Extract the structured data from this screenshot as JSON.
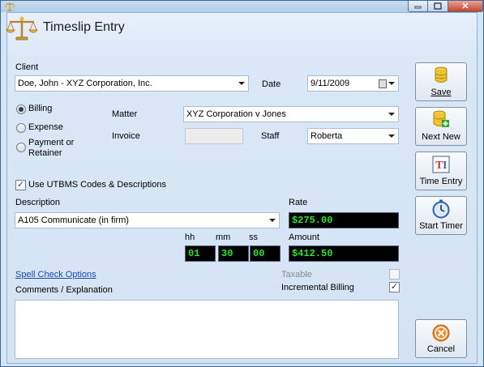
{
  "header": {
    "title": "Timeslip Entry"
  },
  "client": {
    "label": "Client",
    "value": "Doe, John - XYZ Corporation, Inc."
  },
  "date": {
    "label": "Date",
    "value": "9/11/2009"
  },
  "type_options": {
    "billing": "Billing",
    "expense": "Expense",
    "payment": "Payment or",
    "payment_line2": "Retainer",
    "selected": "Billing"
  },
  "matter": {
    "label": "Matter",
    "value": "XYZ Corporation v Jones"
  },
  "invoice": {
    "label": "Invoice",
    "value": ""
  },
  "staff": {
    "label": "Staff",
    "value": "Roberta"
  },
  "utbms": {
    "label": "Use UTBMS Codes & Descriptions",
    "checked": true
  },
  "description": {
    "label": "Description",
    "value": "A105 Communicate (in firm)"
  },
  "rate": {
    "label": "Rate",
    "value": "$275.00"
  },
  "time": {
    "hh_label": "hh",
    "mm_label": "mm",
    "ss_label": "ss",
    "hh": "01",
    "mm": "30",
    "ss": "00"
  },
  "amount": {
    "label": "Amount",
    "value": "$412.50"
  },
  "spell_check": "Spell Check Options",
  "comments": {
    "label": "Comments / Explanation",
    "value": ""
  },
  "taxable": {
    "label": "Taxable",
    "checked": false
  },
  "incremental": {
    "label": "Incremental Billing",
    "checked": true
  },
  "buttons": {
    "save": "Save",
    "next_new": "Next New",
    "time_entry": "Time Entry",
    "start_timer": "Start Timer",
    "cancel": "Cancel"
  },
  "colors": {
    "green_text": "#2ee62e",
    "display_bg": "#000000",
    "link": "#1a47b0"
  }
}
